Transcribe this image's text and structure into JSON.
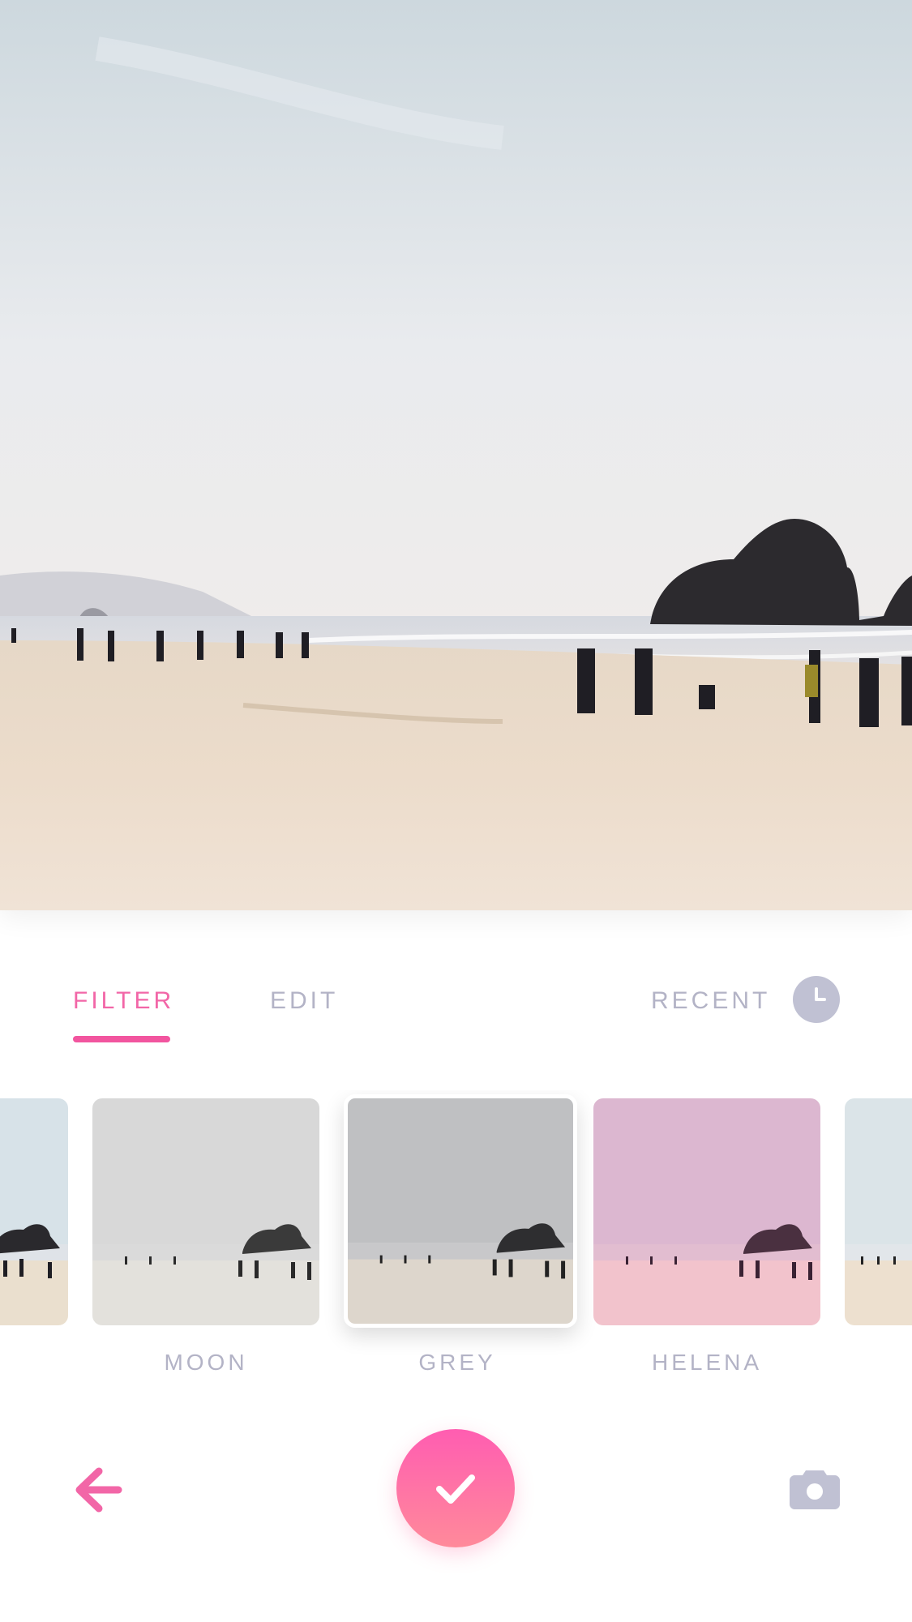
{
  "photo": {
    "description_icon": "beach-photo"
  },
  "tabs": [
    {
      "label": "FILTER",
      "active": true
    },
    {
      "label": "EDIT",
      "active": false
    },
    {
      "label": "RECENT",
      "active": false
    }
  ],
  "recent_icon": "clock-icon",
  "filters": [
    {
      "label": "",
      "tint": "#eaf2f6"
    },
    {
      "label": "MOON",
      "tint": "#e6e6e6"
    },
    {
      "label": "GREY",
      "tint": "#c9c9c9",
      "selected": true
    },
    {
      "label": "HELENA",
      "tint": "#f4a9d4"
    },
    {
      "label": "",
      "tint": "#eef3f4"
    }
  ],
  "bottom_bar": {
    "back_icon": "arrow-left-icon",
    "confirm_icon": "checkmark-icon",
    "camera_icon": "camera-icon"
  },
  "colors": {
    "accent": "#f266a7",
    "inactive_text": "#b3b3c6",
    "confirm_gradient_top": "#ff5db1",
    "confirm_gradient_bottom": "#ff8a9a"
  }
}
